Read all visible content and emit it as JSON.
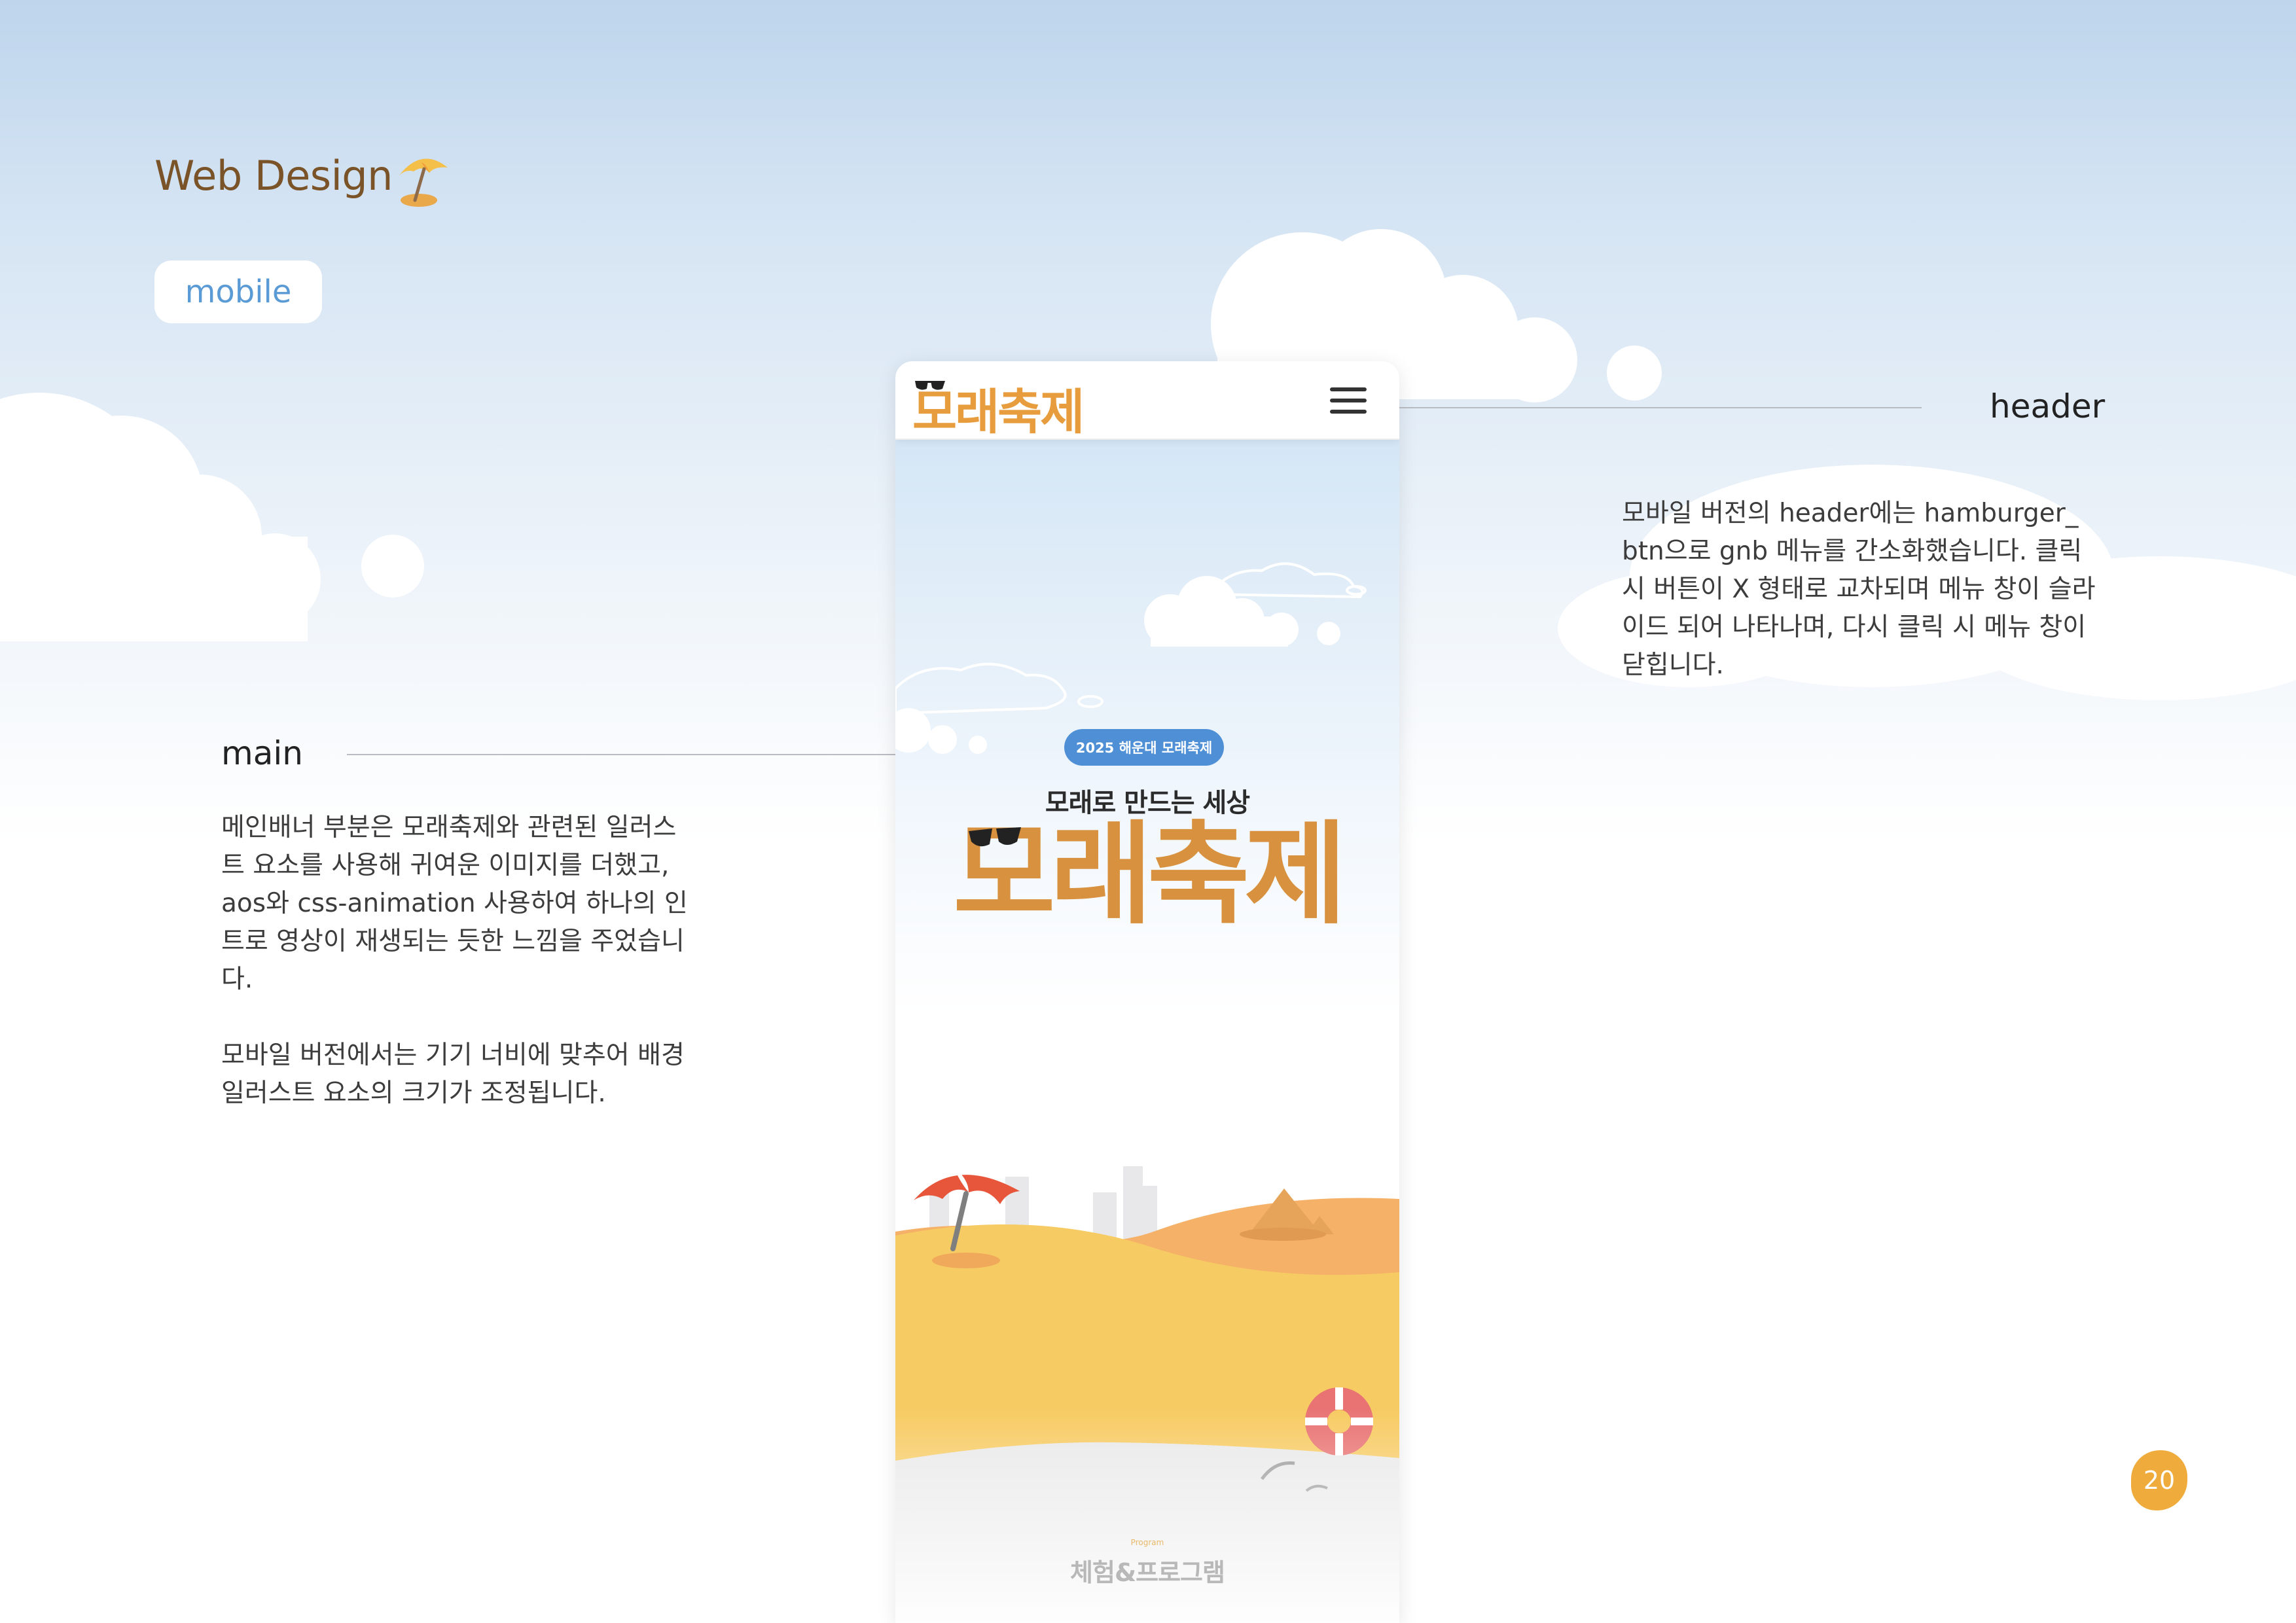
{
  "page": {
    "title": "Web Design",
    "tag": "mobile",
    "page_number": "20"
  },
  "annotations": {
    "header": {
      "label": "header",
      "lines": [
        "모바일 버전의 header에는 hamburger_",
        "btn으로 gnb 메뉴를 간소화했습니다. 클릭",
        "시 버튼이 X 형태로 교차되며 메뉴 창이 슬라",
        "이드 되어 나타나며, 다시 클릭 시 메뉴 창이",
        "닫힙니다."
      ]
    },
    "main": {
      "label": "main",
      "paragraph1": [
        "메인배너 부분은 모래축제와 관련된 일러스",
        "트 요소를 사용해 귀여운 이미지를 더했고,",
        "aos와 css-animation 사용하여 하나의 인",
        "트로  영상이 재생되는 듯한 느낌을 주었습니",
        "다."
      ],
      "paragraph2": [
        "모바일 버전에서는 기기 너비에 맞추어 배경",
        "일러스트 요소의 크기가 조정됩니다."
      ]
    }
  },
  "phone": {
    "logo": "모래축제",
    "menu_icon": "hamburger-icon",
    "badge": "2025 해운대 모래축제",
    "subtitle": "모래로 만드는 세상",
    "hero_title": "모래축제",
    "section_label": "Program",
    "section_title": "체험&프로그램"
  },
  "colors": {
    "title_brown": "#7a5428",
    "accent_orange": "#f0a93c",
    "logo_orange": "#e79d3d",
    "badge_blue": "#4e8fd6",
    "tag_blue": "#5b9bd5"
  }
}
